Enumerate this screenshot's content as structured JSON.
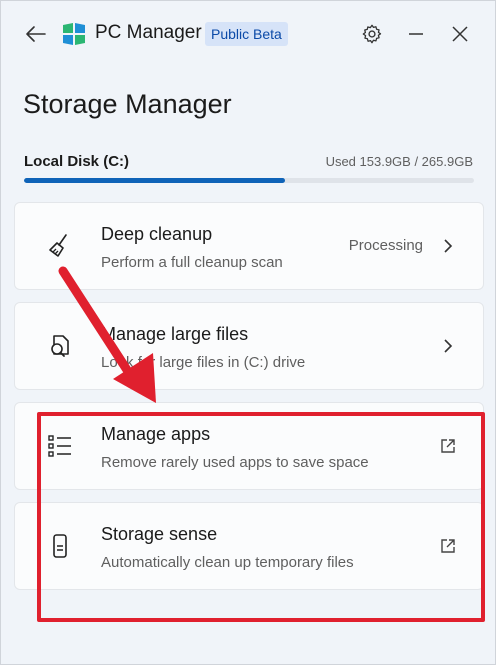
{
  "app": {
    "title": "PC Manager",
    "badge": "Public Beta"
  },
  "page": {
    "title": "Storage Manager"
  },
  "disk": {
    "label": "Local Disk (C:)",
    "usage_text": "Used 153.9GB / 265.9GB",
    "used_fraction": 0.579
  },
  "cards": [
    {
      "title": "Deep cleanup",
      "desc": "Perform a full cleanup scan",
      "status": "Processing",
      "icon": "broom-icon",
      "trail": "chevron-right-icon"
    },
    {
      "title": "Manage large files",
      "desc": "Look for large files in (C:) drive",
      "status": "",
      "icon": "file-search-icon",
      "trail": "chevron-right-icon"
    },
    {
      "title": "Manage apps",
      "desc": "Remove rarely used apps to save space",
      "status": "",
      "icon": "list-icon",
      "trail": "external-link-icon"
    },
    {
      "title": "Storage sense",
      "desc": "Automatically clean up temporary files",
      "status": "",
      "icon": "phone-storage-icon",
      "trail": "external-link-icon"
    }
  ],
  "colors": {
    "accent": "#0f63b8",
    "annotation": "#e0202e"
  }
}
